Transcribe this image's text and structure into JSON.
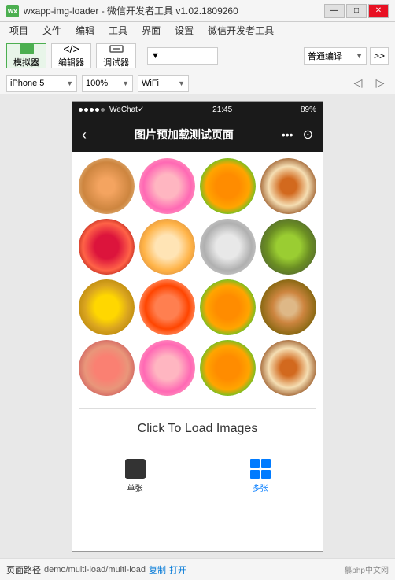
{
  "titleBar": {
    "icon": "wx",
    "title": "wxapp-img-loader - 微信开发者工具 v1.02.1809260",
    "minimize": "—",
    "maximize": "□",
    "close": "✕"
  },
  "menuBar": {
    "items": [
      "项目",
      "文件",
      "编辑",
      "工具",
      "界面",
      "设置",
      "微信开发者工具"
    ]
  },
  "toolbar": {
    "simulator": "模拟器",
    "editor": "编辑器",
    "debugger": "调试器",
    "encodeLabel": "普通编译",
    "expandBtn": ">>"
  },
  "deviceBar": {
    "device": "iPhone 5",
    "zoom": "100%",
    "network": "WiFi"
  },
  "phoneScreen": {
    "statusBar": {
      "dots": "●●●●●",
      "app": "WeChat✓",
      "time": "21:45",
      "battery": "89%"
    },
    "navBar": {
      "title": "图片预加载测试页面",
      "menuIcon": "•••",
      "recordIcon": "⊙"
    },
    "loadButton": "Click To Load Images"
  },
  "tabBar": {
    "items": [
      {
        "label": "单张",
        "active": false
      },
      {
        "label": "多张",
        "active": true
      }
    ]
  },
  "footer": {
    "prefix": "页面路径",
    "path": "demo/multi-load/multi-load",
    "copy": "复制",
    "open": "打开",
    "logo": "慕php中文网"
  }
}
